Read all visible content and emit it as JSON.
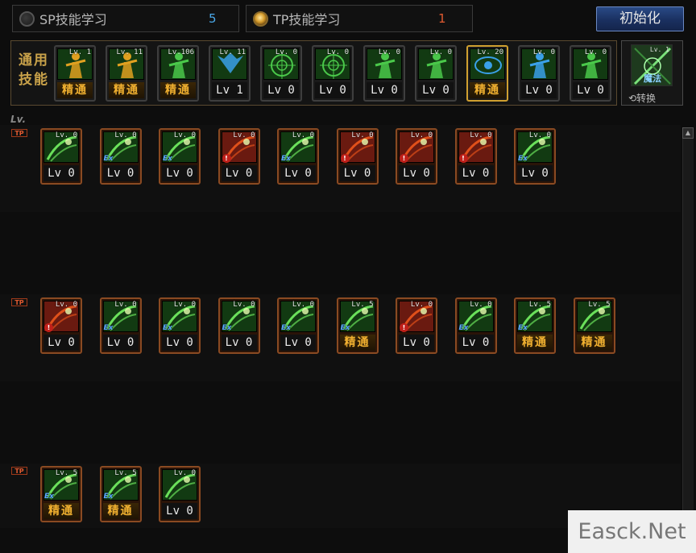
{
  "tabs": {
    "sp": {
      "label": "SP技能学习",
      "value": "5"
    },
    "tp": {
      "label": "TP技能学习",
      "value": "1"
    }
  },
  "reset_label": "初始化",
  "common": {
    "label": "通用技能",
    "skills": [
      {
        "icon": "figure-icon",
        "top_level": "Lv. 1",
        "level": "精通",
        "master": true,
        "color": "#e0a020"
      },
      {
        "icon": "figure-icon",
        "top_level": "Lv. 11",
        "level": "精通",
        "master": true,
        "color": "#e0a020"
      },
      {
        "icon": "beast-icon",
        "top_level": "Lv.106",
        "level": "精通",
        "master": true,
        "color": "#4ac84a"
      },
      {
        "icon": "wings-icon",
        "top_level": "Lv. 11",
        "level": "Lv 1",
        "master": false,
        "color": "#3aa0e8"
      },
      {
        "icon": "target-icon",
        "top_level": "Lv. 0",
        "level": "Lv 0",
        "master": false,
        "color": "#4ac84a"
      },
      {
        "icon": "target-icon",
        "top_level": "Lv. 0",
        "level": "Lv 0",
        "master": false,
        "color": "#4ac84a"
      },
      {
        "icon": "figure-icon",
        "top_level": "Lv. 0",
        "level": "Lv 0",
        "master": false,
        "color": "#4ac84a"
      },
      {
        "icon": "figure-icon",
        "top_level": "Lv. 0",
        "level": "Lv 0",
        "master": false,
        "color": "#4ac84a"
      },
      {
        "icon": "eye-icon",
        "top_level": "Lv. 20",
        "level": "精通",
        "master": true,
        "color": "#3aa0e8",
        "selected": true
      },
      {
        "icon": "figure-icon",
        "top_level": "Lv. 0",
        "level": "Lv 0",
        "master": false,
        "color": "#3aa0e8"
      },
      {
        "icon": "figure-icon",
        "top_level": "Lv. 0",
        "level": "Lv 0",
        "master": false,
        "color": "#4ac84a"
      }
    ],
    "magic": {
      "label": "魔法",
      "switch_label": "⟲转换",
      "top_level": "Lv. 1"
    }
  },
  "lv_header": "Lv.",
  "tp_mark": "TP",
  "rows": [
    {
      "skills": [
        {
          "top_level": "Lv. 0",
          "level": "Lv 0",
          "tag": "none",
          "bg": "green"
        },
        {
          "top_level": "Lv. 0",
          "level": "Lv 0",
          "tag": "Ex",
          "bg": "green"
        },
        {
          "top_level": "Lv. 0",
          "level": "Lv 0",
          "tag": "Ex",
          "bg": "green"
        },
        {
          "top_level": "Lv. 0",
          "level": "Lv 0",
          "tag": "lock",
          "bg": "red"
        },
        {
          "top_level": "Lv. 0",
          "level": "Lv 0",
          "tag": "Ex",
          "bg": "green"
        },
        {
          "top_level": "Lv. 0",
          "level": "Lv 0",
          "tag": "lock",
          "bg": "red"
        },
        {
          "top_level": "Lv. 0",
          "level": "Lv 0",
          "tag": "lock",
          "bg": "red"
        },
        {
          "top_level": "Lv. 0",
          "level": "Lv 0",
          "tag": "lock",
          "bg": "red"
        },
        {
          "top_level": "Lv. 0",
          "level": "Lv 0",
          "tag": "Ex",
          "bg": "green"
        }
      ]
    },
    {
      "skills": [
        {
          "top_level": "Lv. 0",
          "level": "Lv 0",
          "tag": "lock",
          "bg": "red"
        },
        {
          "top_level": "Lv. 0",
          "level": "Lv 0",
          "tag": "Ex",
          "bg": "green"
        },
        {
          "top_level": "Lv. 0",
          "level": "Lv 0",
          "tag": "Ex",
          "bg": "green"
        },
        {
          "top_level": "Lv. 0",
          "level": "Lv 0",
          "tag": "Ex",
          "bg": "green"
        },
        {
          "top_level": "Lv. 0",
          "level": "Lv 0",
          "tag": "Ex",
          "bg": "green"
        },
        {
          "top_level": "Lv. 5",
          "level": "精通",
          "tag": "Ex",
          "bg": "green",
          "master": true
        },
        {
          "top_level": "Lv. 0",
          "level": "Lv 0",
          "tag": "lock",
          "bg": "red"
        },
        {
          "top_level": "Lv. 0",
          "level": "Lv 0",
          "tag": "Ex",
          "bg": "green"
        },
        {
          "top_level": "Lv. 5",
          "level": "精通",
          "tag": "Ex",
          "bg": "green",
          "master": true
        },
        {
          "top_level": "Lv. 5",
          "level": "精通",
          "tag": "none",
          "bg": "green",
          "master": true
        }
      ]
    },
    {
      "skills": [
        {
          "top_level": "Lv. 5",
          "level": "精通",
          "tag": "Ex",
          "bg": "green",
          "master": true
        },
        {
          "top_level": "Lv. 5",
          "level": "精通",
          "tag": "Ex",
          "bg": "green",
          "master": true
        },
        {
          "top_level": "Lv. 0",
          "level": "Lv 0",
          "tag": "none",
          "bg": "green"
        }
      ]
    }
  ],
  "watermark": "Easck.Net",
  "colors": {
    "accent_gold": "#c9a24a",
    "sp_blue": "#4aa8e8",
    "tp_orange": "#e05a30",
    "master_text": "#f0b030"
  }
}
